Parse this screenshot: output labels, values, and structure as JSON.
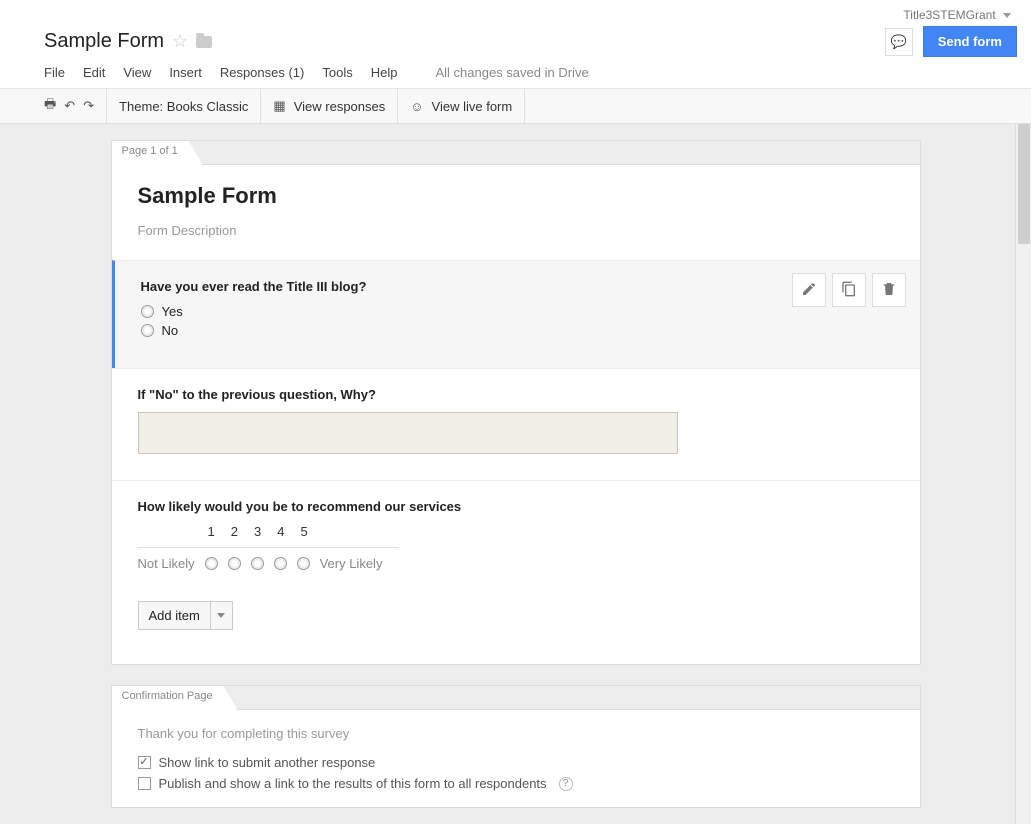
{
  "account": {
    "name": "Title3STEMGrant"
  },
  "doc": {
    "title": "Sample Form"
  },
  "buttons": {
    "send": "Send form"
  },
  "menu": {
    "file": "File",
    "edit": "Edit",
    "view": "View",
    "insert": "Insert",
    "responses": "Responses (1)",
    "tools": "Tools",
    "help": "Help",
    "status": "All changes saved in Drive"
  },
  "toolbar": {
    "theme": "Theme: Books Classic",
    "view_responses": "View responses",
    "view_live": "View live form"
  },
  "page_tab": "Page 1 of 1",
  "form": {
    "title": "Sample Form",
    "description": "Form Description",
    "q1": {
      "title": "Have you ever read the Title III blog?",
      "opt1": "Yes",
      "opt2": "No"
    },
    "q2": {
      "title": "If \"No\" to the previous question, Why?"
    },
    "q3": {
      "title": "How likely would you be to recommend our services",
      "nums": [
        "1",
        "2",
        "3",
        "4",
        "5"
      ],
      "low": "Not Likely",
      "high": "Very Likely"
    },
    "add_item": "Add item"
  },
  "confirm": {
    "tab": "Confirmation Page",
    "message": "Thank you for completing this survey",
    "opt1": "Show link to submit another response",
    "opt2": "Publish and show a link to the results of this form to all respondents"
  }
}
